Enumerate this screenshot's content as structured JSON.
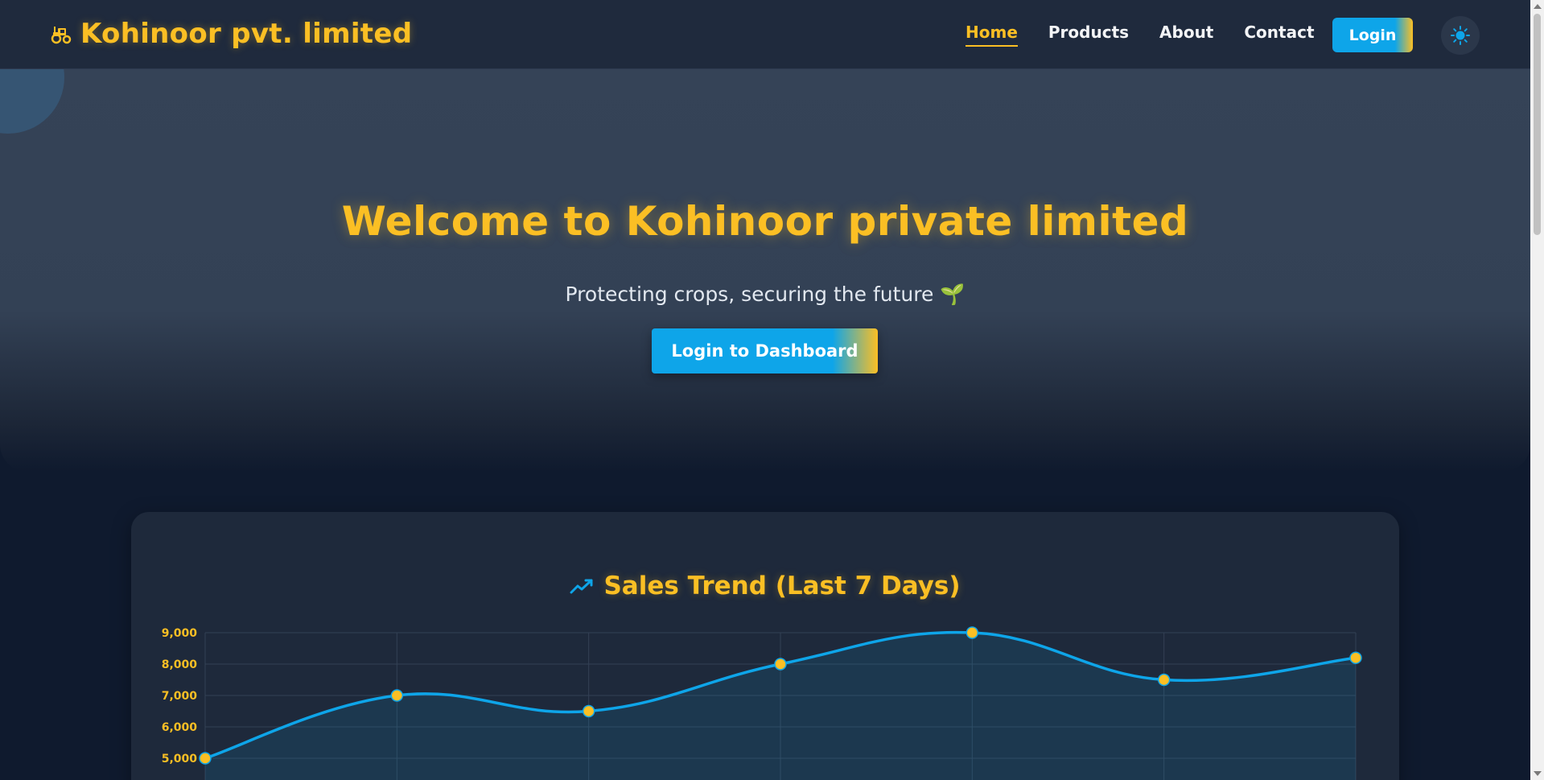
{
  "navbar": {
    "brand_icon": "tractor-icon",
    "brand": "Kohinoor pvt. limited",
    "links": [
      {
        "label": "Home",
        "active": true
      },
      {
        "label": "Products",
        "active": false
      },
      {
        "label": "About",
        "active": false
      },
      {
        "label": "Contact",
        "active": false
      }
    ],
    "login_label": "Login",
    "theme_icon": "sun-icon"
  },
  "hero": {
    "title": "Welcome to Kohinoor private limited",
    "subtitle": "Protecting crops, securing the future 🌱",
    "cta_label": "Login to Dashboard"
  },
  "chart_section": {
    "icon": "trend-up-icon",
    "title": "Sales Trend (Last 7 Days)"
  },
  "chart_data": {
    "type": "line",
    "title": "Sales Trend (Last 7 Days)",
    "series": [
      {
        "values": [
          5000,
          7000,
          6500,
          8000,
          9000,
          7500,
          8200
        ]
      }
    ],
    "y_ticks": [
      "9,000",
      "8,000",
      "7,000",
      "6,000",
      "5,000"
    ],
    "ylim_visible": [
      5000,
      9000
    ],
    "grid": true,
    "fill": true
  },
  "colors": {
    "accent": "#fbbf24",
    "primary": "#0ea5e9",
    "background": "#0f1a2e",
    "card": "#1e293b"
  }
}
